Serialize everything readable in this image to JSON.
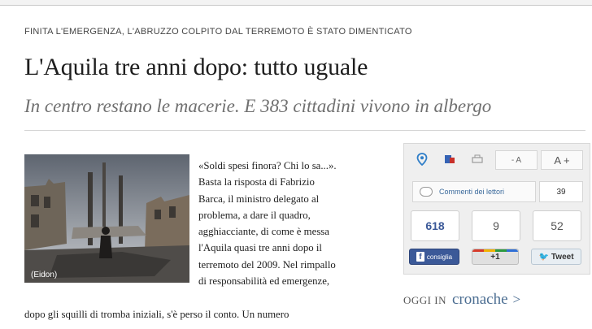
{
  "kicker": "FINITA L'EMERGENZA, L'ABRUZZO COLPITO DAL TERREMOTO È STATO DIMENTICATO",
  "title": "L'Aquila tre anni dopo: tutto uguale",
  "subtitle": "In centro restano le macerie. E 383 cittadini vivono in albergo",
  "photo": {
    "caption": "(Eidon)"
  },
  "article_lines": [
    "«Soldi spesi finora? Chi lo sa...».",
    "Basta la risposta di Fabrizio",
    "Barca, il ministro delegato al",
    "problema, a dare il quadro,",
    "agghiacciante, di come è messa",
    "l'Aquila quasi tre anni dopo il",
    "terremoto del 2009. Nel rimpallo",
    "di responsabilità ed emergenze,"
  ],
  "article_continued": "dopo gli squilli di tromba iniziali, s'è perso il conto. Un numero",
  "toolbar": {
    "font_smaller": "- A",
    "font_larger": "A +",
    "comments_label": "Commenti dei lettori",
    "comments_count": "39"
  },
  "social": {
    "facebook_count": "618",
    "plusone_count": "9",
    "tweet_count": "52",
    "facebook_label": "consiglia",
    "plusone_label": "+1",
    "tweet_label": "Tweet"
  },
  "oggi": {
    "prefix": "OGGI IN",
    "section": "cronache",
    "arrow": ">"
  },
  "icons": [
    "location-icon",
    "share-icon",
    "print-icon",
    "font-decrease-icon",
    "font-increase-icon",
    "comment-bubble-icon",
    "facebook-icon",
    "twitter-bird-icon"
  ],
  "colors": {
    "link": "#4c6e92",
    "facebook": "#3b5998",
    "subtitle": "#707070"
  }
}
